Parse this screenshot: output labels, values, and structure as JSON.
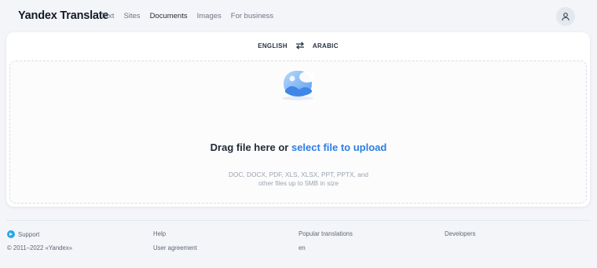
{
  "header": {
    "logo": "Yandex Translate",
    "nav": [
      "Text",
      "Sites",
      "Documents",
      "Images",
      "For business"
    ],
    "active_nav": "Documents",
    "avatar_icon": "user-icon"
  },
  "languages": {
    "source": "ENGLISH",
    "target": "ARABIC",
    "swap_icon": "swap-arrows-icon"
  },
  "upload": {
    "drag_text": "Drag file here or ",
    "link_text": "select file to upload",
    "formats_line1": "DOC, DOCX, PDF, XLS, XLSX, PPT, PPTX, and",
    "formats_line2": "other files up to 5MB in size",
    "illustration_icon": "image-upload-icon"
  },
  "footer": {
    "support": "Support",
    "help": "Help",
    "popular": "Popular translations",
    "developers": "Developers",
    "copyright": "© 2011–2022 «Yandex»",
    "agreement": "User agreement",
    "lang": "en"
  },
  "colors": {
    "accent": "#2d7de2",
    "background": "#f4f5f8",
    "support_icon": "#2ba7e8"
  }
}
